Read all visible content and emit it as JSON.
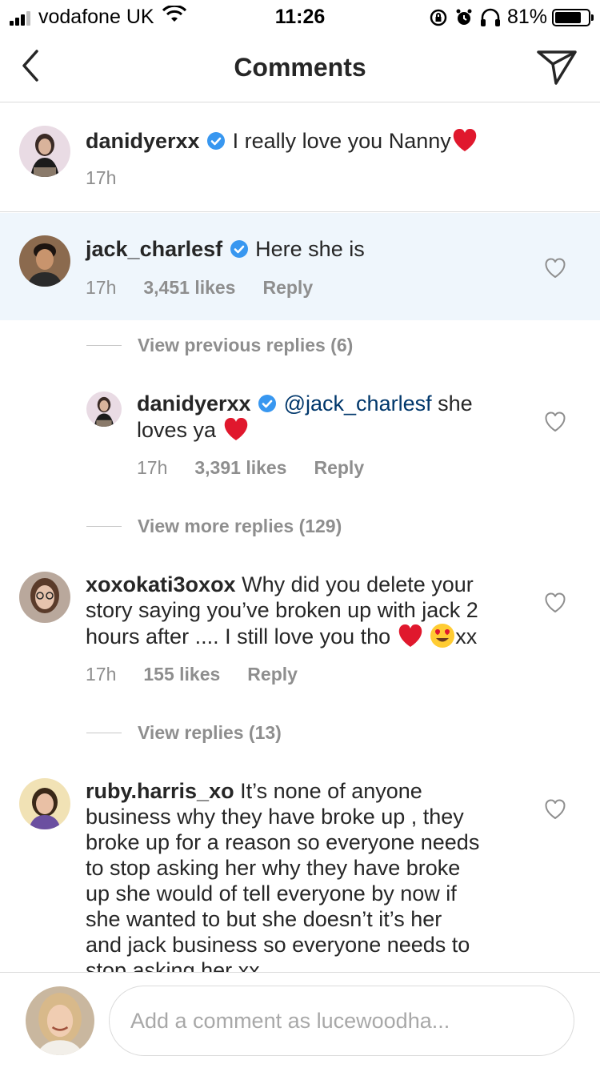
{
  "status_bar": {
    "carrier": "vodafone UK",
    "time": "11:26",
    "battery": "81%",
    "battery_level": 0.81
  },
  "header": {
    "title": "Comments"
  },
  "caption": {
    "username": "danidyerxx",
    "text": "I really love you Nanny",
    "time": "17h"
  },
  "comments": [
    {
      "username": "jack_charlesf",
      "text": "Here she is",
      "time": "17h",
      "likes": "3,451 likes",
      "reply": "Reply",
      "view_previous": "View previous replies (6)",
      "reply_item": {
        "username": "danidyerxx",
        "mention": "@jack_charlesf",
        "text_line1": "she",
        "text_line2": "loves ya",
        "time": "17h",
        "likes": "3,391 likes",
        "reply": "Reply"
      },
      "view_more": "View more replies (129)"
    },
    {
      "username": "xoxokati3oxox",
      "text_line1": "Why did you delete your",
      "text_line2": "story saying you’ve broken up with jack 2",
      "text_line3": "hours after .... I still love you tho",
      "text_suffix": "xx",
      "time": "17h",
      "likes": "155 likes",
      "reply": "Reply",
      "view_replies": "View replies (13)"
    },
    {
      "username": "ruby.harris_xo",
      "text_line1": "It’s none of anyone",
      "text_line2": "business why they have broke up , they",
      "text_line3": "broke up for a reason so everyone needs",
      "text_line4": "to stop asking her why they have broke",
      "text_line5": "up she would of tell everyone by  now if",
      "text_line6": "she wanted to but she doesn’t it’s her",
      "text_line7": "and jack business so everyone needs to",
      "text_line8": "stop asking her xx"
    }
  ],
  "composer": {
    "placeholder": "Add a comment as lucewoodha..."
  },
  "colors": {
    "highlight": "#eff6fc",
    "verified": "#3897f0",
    "heart": "#e0182d",
    "mention": "#00376b"
  },
  "icons": [
    "back-arrow-icon",
    "direct-send-icon",
    "verified-badge-icon",
    "red-heart-emoji",
    "heart-eyes-emoji",
    "like-heart-icon",
    "wifi-icon",
    "signal-icon",
    "battery-icon",
    "alarm-icon",
    "headphones-icon",
    "rotation-lock-icon"
  ]
}
